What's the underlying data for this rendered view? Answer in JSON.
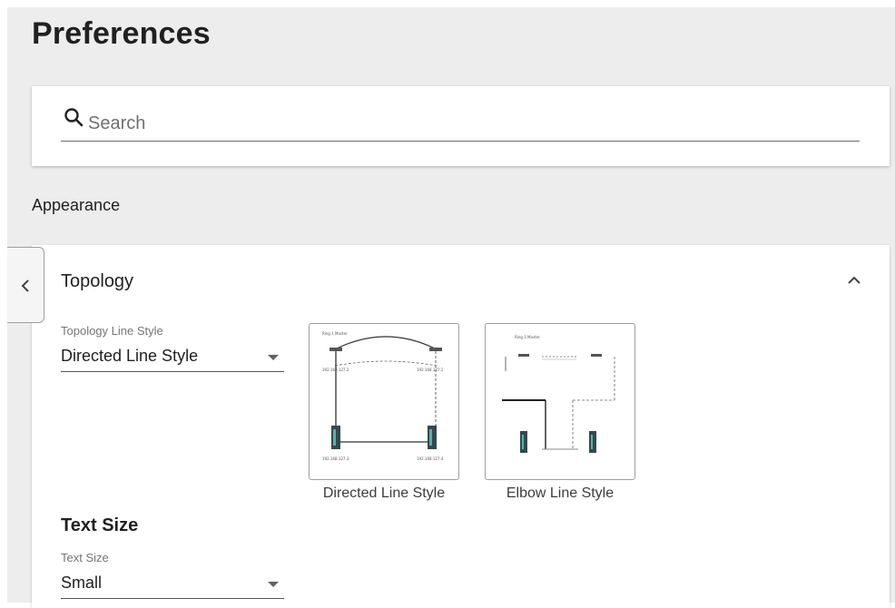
{
  "page": {
    "title": "Preferences"
  },
  "search": {
    "placeholder": "Search",
    "value": ""
  },
  "appearance": {
    "heading": "Appearance",
    "topology": {
      "title": "Topology",
      "expanded": true,
      "line_style_field": {
        "label": "Topology Line Style",
        "value": "Directed Line Style"
      },
      "style_options": [
        {
          "label": "Directed Line Style",
          "selected": true
        },
        {
          "label": "Elbow Line Style",
          "selected": false
        }
      ]
    },
    "text_size": {
      "heading": "Text Size",
      "field": {
        "label": "Text Size",
        "value": "Small"
      }
    }
  },
  "icons": {
    "search": "search-icon",
    "collapse": "chevron-left-icon",
    "expand_toggle": "chevron-up-icon",
    "dropdown": "caret-down-icon"
  },
  "colors": {
    "background": "#ededed",
    "card": "#ffffff",
    "text": "#212121",
    "muted": "#757575"
  }
}
